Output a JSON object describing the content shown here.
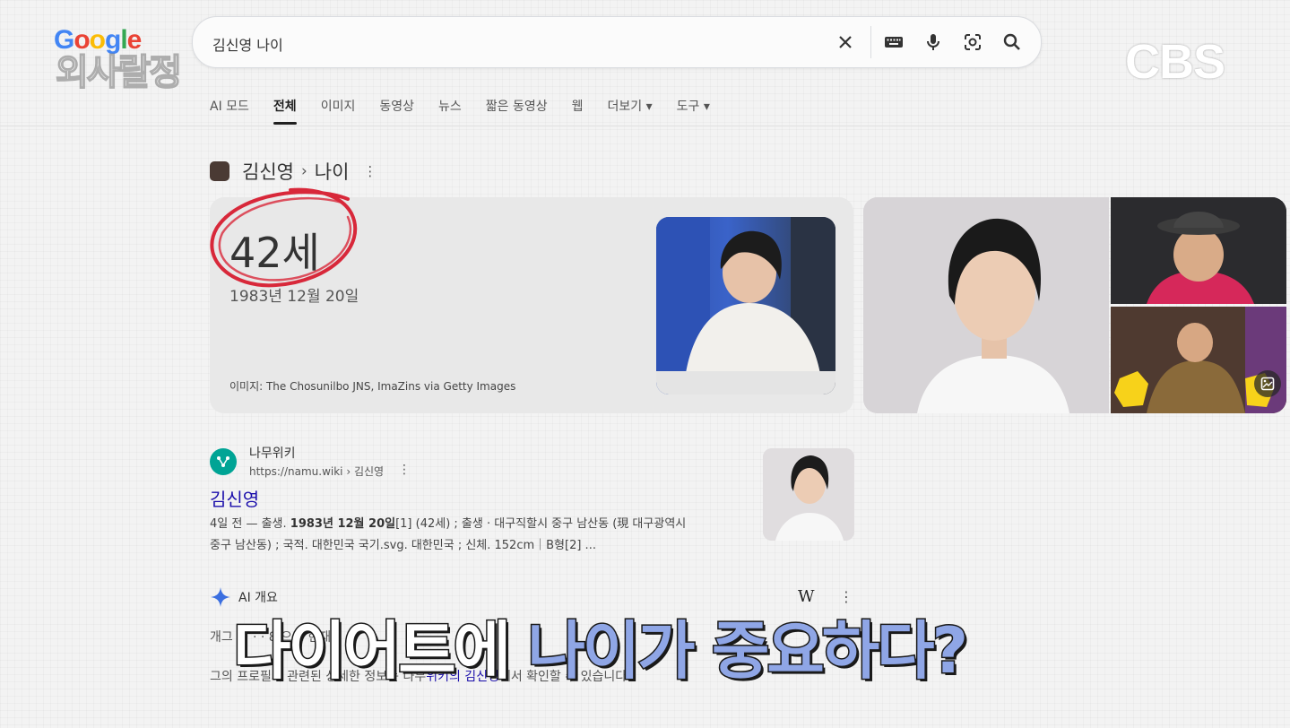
{
  "header": {
    "google_logo": "Google",
    "show_logo": "외사랄정",
    "broadcaster": "CBS"
  },
  "search": {
    "query": "김신영 나이"
  },
  "tabs": [
    {
      "label": "AI 모드"
    },
    {
      "label": "전체"
    },
    {
      "label": "이미지"
    },
    {
      "label": "동영상"
    },
    {
      "label": "뉴스"
    },
    {
      "label": "짧은 동영상"
    },
    {
      "label": "웹"
    },
    {
      "label": "더보기 ▾"
    },
    {
      "label": "도구 ▾"
    }
  ],
  "breadcrumb": {
    "entity": "김신영",
    "separator": "›",
    "attribute": "나이"
  },
  "age_card": {
    "age": "42세",
    "birthdate": "1983년 12월 20일",
    "image_credit": "이미지: The Chosunilbo JNS, ImaZins via Getty Images"
  },
  "result": {
    "site_name": "나무위키",
    "url": "https://namu.wiki › 김신영",
    "title": "김신영",
    "snippet_prefix": "4일 전 — 출생. ",
    "snippet_bold": "1983년 12월 20일",
    "snippet_rest": "[1] (42세) ; 출생 · 대구직할시 중구 남산동 (現 대구광역시",
    "snippet_line2": "중구 남산동) ; 국적. 대한민국 국기.svg. 대한민국 ; 신체. 152cm｜B형[2] ..."
  },
  "ai_overview": {
    "label": "AI 개요",
    "wiki_icon": "W",
    "line1": "개그          ·        ·     ·       ·    8     으로 현재",
    "line2_prefix": "그의 프로필과 관련된 상세한 정보는 나무",
    "line2_link": "위키의 김신영",
    "line2_suffix": "에서 확인할 수 있습니다."
  },
  "caption": {
    "part1": "다이어트에 ",
    "part2": "나이가 중요하다?"
  },
  "colors": {
    "link": "#1a0dab",
    "caption_accent": "#8fa6e6",
    "circle": "#d8283a"
  }
}
